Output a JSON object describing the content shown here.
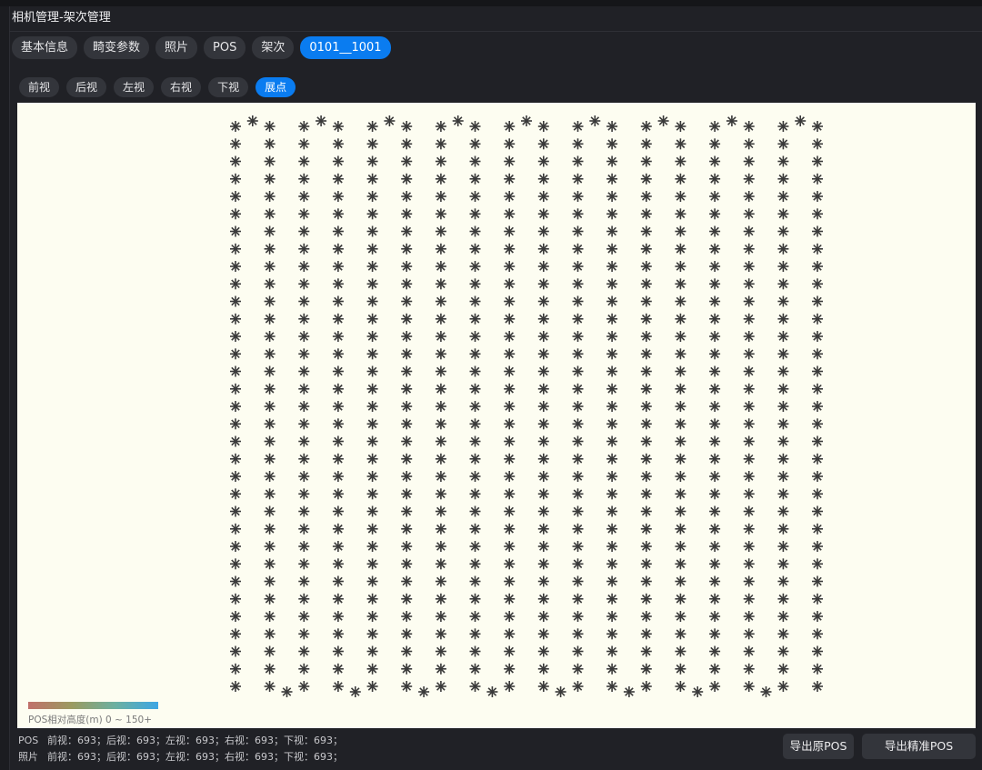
{
  "window": {
    "title": "相机管理-架次管理"
  },
  "main_tabs": [
    {
      "label": "基本信息",
      "active": false
    },
    {
      "label": "畸变参数",
      "active": false
    },
    {
      "label": "照片",
      "active": false
    },
    {
      "label": "POS",
      "active": false
    },
    {
      "label": "架次",
      "active": false
    },
    {
      "label": "0101__1001",
      "active": true
    }
  ],
  "view_tabs": [
    {
      "label": "前视",
      "active": false
    },
    {
      "label": "后视",
      "active": false
    },
    {
      "label": "左视",
      "active": false
    },
    {
      "label": "右视",
      "active": false
    },
    {
      "label": "下视",
      "active": false
    },
    {
      "label": "展点",
      "active": true
    }
  ],
  "plot": {
    "marker_icon": "asterisk-marker-icon",
    "flight_strips": 18,
    "legend": {
      "label": "POS相对高度(m) 0 ~ 150+",
      "gradient": [
        "#c0706a",
        "#9b9a60",
        "#6cb0a0",
        "#3da6e4"
      ]
    }
  },
  "status": {
    "pos": {
      "label": "POS",
      "text": "前视：693；后视：693；左视：693；右视：693；下视：693；"
    },
    "photo": {
      "label": "照片",
      "text": "前视：693；后视：693；左视：693；右视：693；下视：693；"
    }
  },
  "buttons": {
    "export_raw": "导出原POS",
    "export_precise": "导出精准POS"
  },
  "colors": {
    "accent": "#0a7cf0",
    "canvas_bg": "#fdfdf1",
    "background": "#202126"
  }
}
